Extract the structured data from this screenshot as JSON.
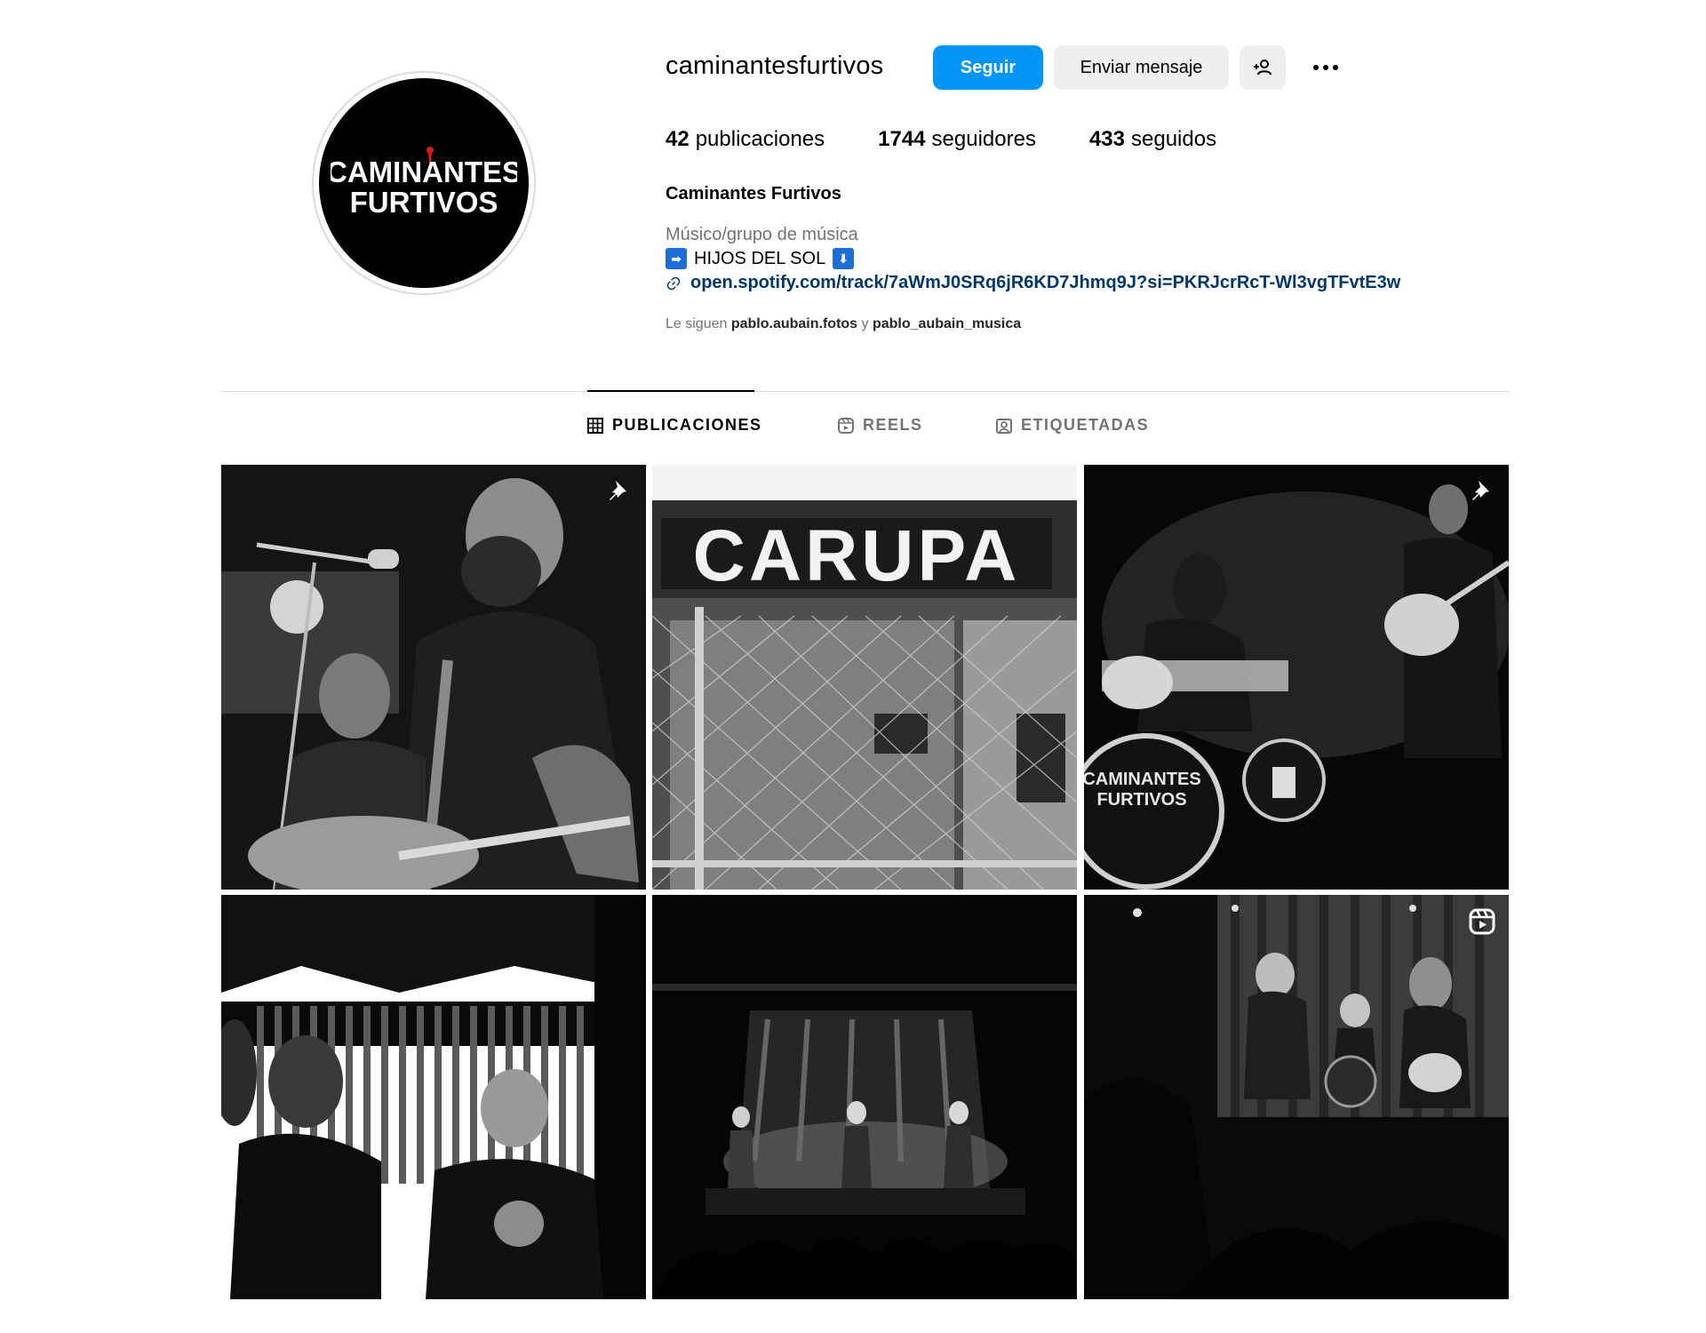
{
  "profile": {
    "username": "caminantesfurtivos",
    "avatar_text_line1": "CAMINANTES",
    "avatar_text_line2": "FURTIVOS",
    "full_name": "Caminantes Furtivos",
    "category": "Músico/grupo de música",
    "bio_text": "HIJOS DEL SOL",
    "bio_emoji_left": "➡",
    "bio_emoji_right": "⬇",
    "link": "open.spotify.com/track/7aWmJ0SRq6jR6KD7Jhmq9J?si=PKRJcrRcT-Wl3vgTFvtE3w",
    "followed_by_prefix": "Le siguen",
    "followed_by_user1": "pablo.aubain.fotos",
    "followed_by_sep": "y",
    "followed_by_user2": "pablo_aubain_musica"
  },
  "actions": {
    "follow_label": "Seguir",
    "message_label": "Enviar mensaje",
    "suggest_icon": "person-add-icon",
    "more_icon": "more-options-icon"
  },
  "stats": {
    "posts_count": "42",
    "posts_label": "publicaciones",
    "followers_count": "1744",
    "followers_label": "seguidores",
    "following_count": "433",
    "following_label": "seguidos"
  },
  "tabs": [
    {
      "label": "PUBLICACIONES",
      "icon": "grid-icon",
      "active": true
    },
    {
      "label": "REELS",
      "icon": "reels-icon",
      "active": false
    },
    {
      "label": "ETIQUETADAS",
      "icon": "tagged-icon",
      "active": false
    }
  ],
  "posts": {
    "post2_sign": "CARUPA",
    "post3_drum_line1": "CAMINANTES",
    "post3_drum_line2": "FURTIVOS"
  },
  "colors": {
    "accent": "#0095f6",
    "link": "#00376b",
    "muted": "#737373",
    "button_bg": "#efefef",
    "divider": "#dbdbdb"
  }
}
